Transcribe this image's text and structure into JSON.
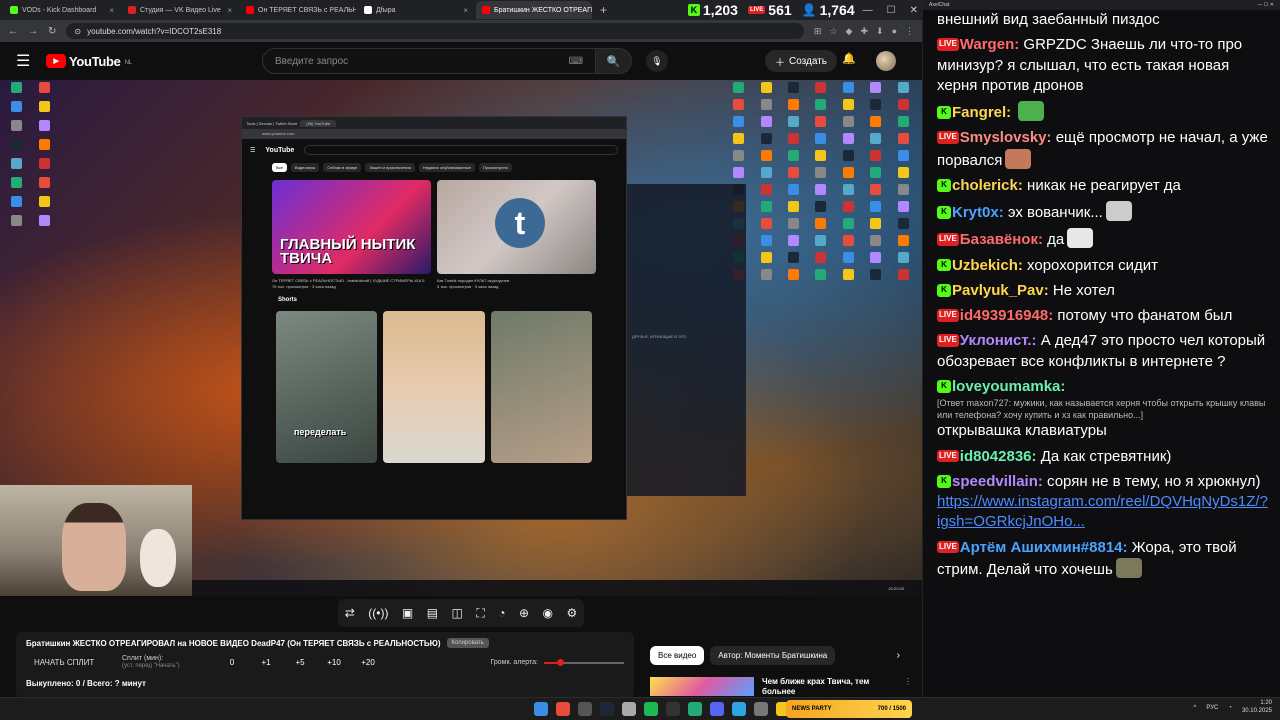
{
  "browser": {
    "tabs": [
      {
        "label": "VODs - Kick Dashboard",
        "color": "#53fc18"
      },
      {
        "label": "Студия — VK Видео Live",
        "color": "#e02020"
      },
      {
        "label": "Он ТЕРЯЕТ СВЯЗЬ с РЕАЛЬНОСТЬЮ",
        "color": "#ff0000"
      },
      {
        "label": "Дfырa",
        "color": "#ffffff"
      },
      {
        "label": "Братишкин ЖЕСТКО ОТРЕАГИРОВАЛ",
        "color": "#ff0000"
      }
    ],
    "url": "youtube.com/watch?v=IDCOT2sE318",
    "counters": {
      "kick": "1,203",
      "vk": "561",
      "viewers": "1,764"
    },
    "kick_badge": "K",
    "live_badge": "LIVE"
  },
  "youtube": {
    "logo": "YouTube",
    "region": "NL",
    "search_placeholder": "Введите запрос",
    "create_label": "Создать"
  },
  "video": {
    "inner_tab_1": "Tools | Decoax | Twitch Store",
    "inner_tab_2": "(26) YouTube",
    "inner_url": "www.youtube.com",
    "inner_logo": "YouTube",
    "chips": [
      "Все",
      "Видеоигры",
      "Сейчас в эфире",
      "Экшен и приключения",
      "Недавно опубликованные",
      "Просмотрено"
    ],
    "thumb1_text": "ГЛАВНЫЙ НЫТИК ТВИЧА",
    "thumb1_title": "Он ТЕРЯЕТ СВЯЗЬ с РЕАЛЬНОСТЬЮ - bratishkinoff | ХУДШИЕ СТРИМЕРЫ #16.5",
    "thumb1_meta": "76 тыс. просмотров · 3 часа назад",
    "thumb2_letter": "t",
    "thumb2_title": "Как Tumbit породил КУЛЬТ скуфчурчев",
    "thumb2_meta": "3 тыс. просмотров · 3 часа назад",
    "shorts_label": "Shorts",
    "short_caption": "переделать",
    "steam_label": "ДРУЗЬЯ, ИГРАЮЩИЕ В ЭТО",
    "taskbar_time": "20:22:00"
  },
  "player": {
    "controls": [
      "⇄",
      "((•))",
      "▣",
      "▤",
      "◫",
      "⛶",
      "◔",
      "⊕",
      "◉",
      "⚙"
    ]
  },
  "split": {
    "title": "Братишкин ЖЕСТКО ОТРЕАГИРОВАЛ на НОВОЕ ВИДЕО DeadP47 (Он ТЕРЯЕТ СВЯЗЬ с РЕАЛЬНОСТЬЮ)",
    "copy_label": "Копировать",
    "start_label": "НАЧАТЬ СПЛИТ",
    "split_label": "Сплит (мин):",
    "split_hint": "(уст. перед \"Начать\")",
    "values": [
      "0",
      "+1",
      "+5",
      "+10",
      "+20"
    ],
    "alert_label": "Громк. алерта:",
    "alert_level": 0.2,
    "progress": "Выкуплено: 0 / Всего: ? минут"
  },
  "filters": [
    "Все видео",
    "Автор: Моменты Братишкина"
  ],
  "rec": {
    "title": "Чем ближе крах Твича, тем больнее"
  },
  "chat": {
    "title": "AxelChat",
    "messages": [
      {
        "platform": "",
        "user": "",
        "color": "#ffffff",
        "text": "внешний вид заебанный пиздос"
      },
      {
        "platform": "vk",
        "user": "Wargen:",
        "color": "#ff6b6b",
        "text": "GRPZDC Знаешь ли что-то про минизур? я слышал, что есть такая новая херня против дронов"
      },
      {
        "platform": "kick",
        "user": "Fangrel:",
        "color": "#ffd54f",
        "text": "",
        "emote": "#4caf50"
      },
      {
        "platform": "vk",
        "user": "Smyslovsky:",
        "color": "#ff8a80",
        "text": "ещё просмотр не начал, а уже порвался",
        "emote": "#c47a5a"
      },
      {
        "platform": "kick",
        "user": "cholerick:",
        "color": "#ffd54f",
        "text": "никак не реагирует да"
      },
      {
        "platform": "kick",
        "user": "Kryt0x:",
        "color": "#4aa3ff",
        "text": "эх вованчик...",
        "emote": "#cccccc"
      },
      {
        "platform": "vk",
        "user": "Базавёнок:",
        "color": "#ff6b6b",
        "text": "да",
        "emote": "#e8e8e8"
      },
      {
        "platform": "kick",
        "user": "Uzbekich:",
        "color": "#ffd54f",
        "text": "хорохорится сидит"
      },
      {
        "platform": "kick",
        "user": "Pavlyuk_Pav:",
        "color": "#ffd54f",
        "text": "Не хотел"
      },
      {
        "platform": "vk",
        "user": "id493916948:",
        "color": "#ff6b6b",
        "text": "потому что фанатом был"
      },
      {
        "platform": "vk",
        "user": "Уклонист.:",
        "color": "#b388ff",
        "text": "А дед47 это просто чел который обозревает все конфликты в интернете ?"
      },
      {
        "platform": "kick",
        "user": "loveyoumamka:",
        "color": "#69f0ae",
        "text": "",
        "reply": "[Ответ maxon727: мужики, как называется херня чтобы открыть крышку клавы или телефона? хочу купить и хз как правильно...]",
        "after": "открывашка клавиатуры"
      },
      {
        "platform": "vk",
        "user": "id8042836:",
        "color": "#69f0ae",
        "text": "Да как стревятник)"
      },
      {
        "platform": "kick",
        "user": "speedvillain:",
        "color": "#b388ff",
        "text": "сорян не в тему, но я хрюкнул)",
        "link": "https://www.instagram.com/reel/DQVHqNyDs1Z/?igsh=OGRkcjJnOHo..."
      },
      {
        "platform": "vk",
        "user": "Артём Ашихмин#8814:",
        "color": "#4aa3ff",
        "text": "Жора, это твой стрим. Делай что хочешь",
        "emote": "#7a7a5a"
      }
    ]
  },
  "taskbar": {
    "widget_label": "NEWS PARTY",
    "widget_count": "700 / 1500",
    "lang": "РУС",
    "time": "1:20",
    "date": "30.10.2025"
  }
}
